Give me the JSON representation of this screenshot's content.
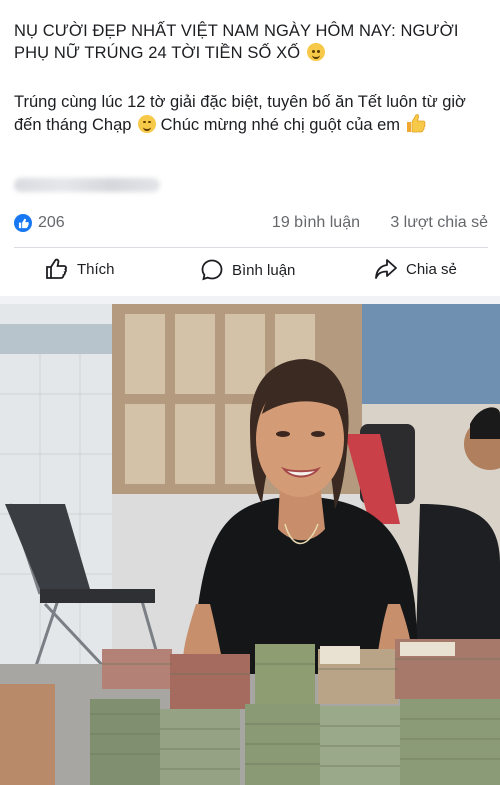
{
  "post": {
    "headline": "NỤ CƯỜI ĐẸP NHẤT VIỆT NAM NGÀY HÔM NAY: NGƯỜI PHỤ NỮ TRÚNG 24 TỜI TIỀN SỐ XỐ",
    "body_part1": "Trúng cùng lúc 12 tờ giải đặc biệt, tuyên bố ăn Tết luôn từ giờ đến tháng Chạp",
    "body_part2": "Chúc mừng nhé chị guột của em",
    "reactions": {
      "count": "206",
      "icon": "like-icon"
    },
    "comments": "19 bình luận",
    "shares": "3 lượt chia sẻ"
  },
  "actions": {
    "like_label": "Thích",
    "comment_label": "Bình luận",
    "share_label": "Chia sẻ"
  },
  "icons": [
    "pleading-face-emoji",
    "smiling-face-emoji",
    "thumbs-up-emoji",
    "like-icon",
    "comment-icon",
    "share-icon"
  ],
  "colors": {
    "accent": "#1877f2",
    "text": "#1c1e21",
    "muted": "#65676b"
  }
}
